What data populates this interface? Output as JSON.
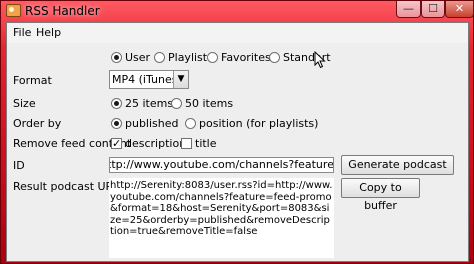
{
  "window": {
    "title": "RSS Handler",
    "minimize_glyph": "—",
    "maximize_glyph": "☐",
    "close_glyph": "✕"
  },
  "menu": {
    "items": [
      "File",
      "Help"
    ]
  },
  "source_type": {
    "options": [
      "User",
      "Playlist",
      "Favorites",
      "Standart"
    ],
    "selected": "User"
  },
  "format": {
    "label": "Format",
    "value": "MP4 (iTunes)",
    "arrow_icon": "chevron-down-icon"
  },
  "size": {
    "label": "Size",
    "options": [
      "25 items",
      "50 items"
    ],
    "selected": "25 items"
  },
  "order_by": {
    "label": "Order by",
    "options": [
      "published",
      "position (for playlists)"
    ],
    "selected": "published"
  },
  "remove_feed_content": {
    "label": "Remove feed content",
    "options": [
      {
        "label": "description",
        "checked": true
      },
      {
        "label": "title",
        "checked": false
      }
    ]
  },
  "id": {
    "label": "ID",
    "value": "ttp://www.youtube.com/channels?feature=feed-promo"
  },
  "result": {
    "label": "Result podcast URL",
    "value": "http://Serenity:8083/user.rss?id=http://www.youtube.com/channels?feature=feed-promo&format=18&host=Serenity&port=8083&size=25&orderby=published&removeDescription=true&removeTitle=false"
  },
  "buttons": {
    "generate": "Generate podcast URL",
    "copy": "Copy to buffer"
  },
  "theme": {
    "titlebar_color": "#e7242f",
    "client_bg": "#eeeeee"
  }
}
